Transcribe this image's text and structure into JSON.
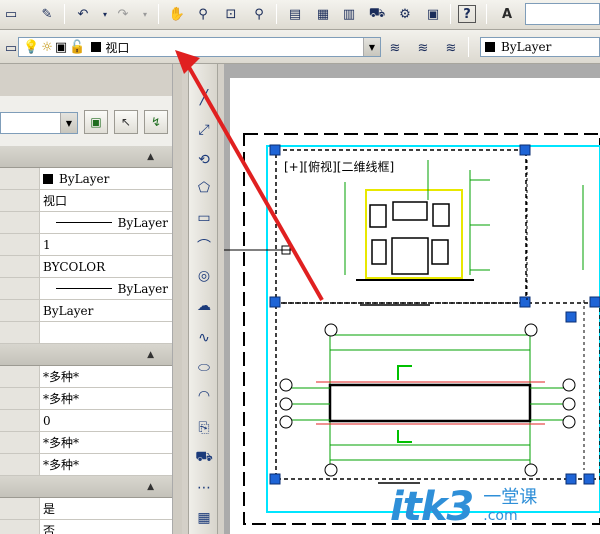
{
  "toolbar_top": {
    "icons": [
      "folder-icon",
      "save-icon",
      "undo-icon",
      "redo-icon",
      "pan-icon",
      "zoom-realtime-icon",
      "zoom-window-icon",
      "zoom-previous-icon",
      "properties-icon",
      "design-center-icon",
      "tool-palettes-icon",
      "markup-icon",
      "sheet-set-icon",
      "calculator-icon",
      "help-icon",
      "text-style-icon"
    ],
    "help_label": "?"
  },
  "layer_toolbar": {
    "current_layer": "视口",
    "color_bylayer": "ByLayer"
  },
  "properties": {
    "general_rows": [
      {
        "value": "ByLayer",
        "kind": "color"
      },
      {
        "value": "视口",
        "kind": "text"
      },
      {
        "value": "ByLayer",
        "kind": "line"
      },
      {
        "value": "1",
        "kind": "text"
      },
      {
        "value": "BYCOLOR",
        "kind": "text"
      },
      {
        "value": "ByLayer",
        "kind": "line"
      },
      {
        "value": "ByLayer",
        "kind": "text"
      }
    ],
    "geometry_rows": [
      "*多种*",
      "*多种*",
      "0",
      "*多种*",
      "*多种*"
    ],
    "misc_rows": [
      "是",
      "否"
    ]
  },
  "viewport": {
    "label": "[+][俯视][二维线框]"
  },
  "watermark": {
    "brand": "itk3",
    "cn_top": "一堂课",
    "domain": ".com"
  },
  "colors": {
    "accent_cyan": "#00e5ff",
    "grip_blue": "#1e64d6",
    "arrow_red": "#e02020",
    "drawing_green": "#00a000",
    "drawing_yellow": "#f0f000"
  }
}
